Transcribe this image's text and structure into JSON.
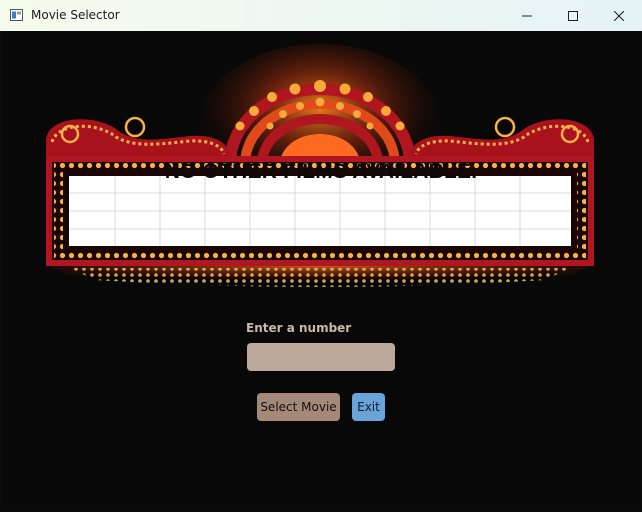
{
  "window": {
    "title": "Movie Selector",
    "icons": {
      "app": "window-app-icon",
      "minimize": "minimize-icon",
      "maximize": "maximize-icon",
      "close": "close-icon"
    }
  },
  "marquee": {
    "text": "NO OTHER FILMS AVAILABLE."
  },
  "form": {
    "label": "Enter a number",
    "input_value": "",
    "input_placeholder": "",
    "select_button": "Select Movie",
    "exit_button": "Exit"
  },
  "colors": {
    "background": "#080808",
    "label": "#cdb8a7",
    "input": "#bda99c",
    "select_button": "#a48979",
    "exit_button": "#6aa3d8",
    "marquee_frame": "#b0161f",
    "bulb": "#f5b44a"
  }
}
